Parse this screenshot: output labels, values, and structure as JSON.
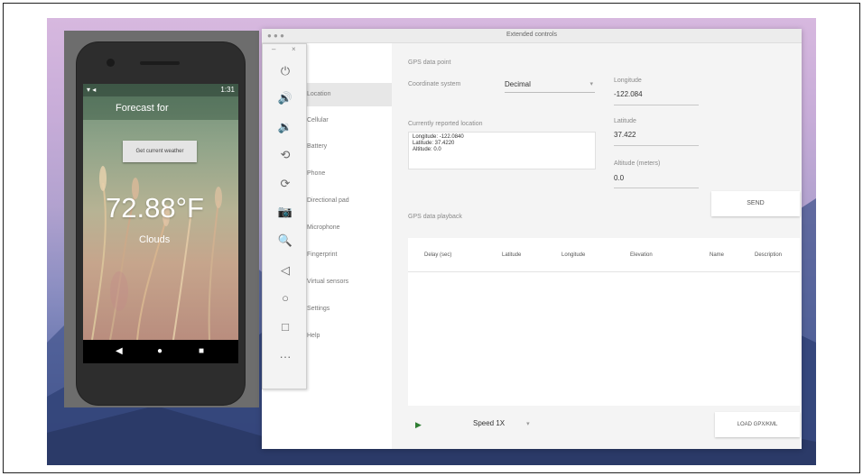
{
  "phone": {
    "status_left": "▾ ◂",
    "status_time": "1:31",
    "app_title": "Forecast for",
    "weather_button": "Get current weather",
    "temperature": "72.88°F",
    "condition": "Clouds"
  },
  "nav": {
    "back": "◀",
    "home": "●",
    "recents": "■"
  },
  "toolbar": {
    "window_controls": "×",
    "window_min": "–",
    "tools": [
      {
        "name": "power-icon",
        "glyph": "⏻"
      },
      {
        "name": "volume-up-icon",
        "glyph": "🔊"
      },
      {
        "name": "volume-down-icon",
        "glyph": "🔉"
      },
      {
        "name": "rotate-left-icon",
        "glyph": "⟲"
      },
      {
        "name": "rotate-right-icon",
        "glyph": "⟳"
      },
      {
        "name": "camera-icon",
        "glyph": "📷"
      },
      {
        "name": "zoom-icon",
        "glyph": "🔍"
      },
      {
        "name": "back-icon",
        "glyph": "◁"
      },
      {
        "name": "home-icon",
        "glyph": "○"
      },
      {
        "name": "overview-icon",
        "glyph": "□"
      },
      {
        "name": "more-icon",
        "glyph": "···"
      }
    ]
  },
  "window": {
    "title": "Extended controls",
    "dots": "● ● ●",
    "sidebar": [
      {
        "label": "Location",
        "active": true
      },
      {
        "label": "Cellular"
      },
      {
        "label": "Battery"
      },
      {
        "label": "Phone"
      },
      {
        "label": "Directional pad"
      },
      {
        "label": "Microphone"
      },
      {
        "label": "Fingerprint"
      },
      {
        "label": "Virtual sensors"
      },
      {
        "label": "Settings"
      },
      {
        "label": "Help"
      }
    ],
    "location": {
      "section_manual": "GPS data point",
      "coord_system_label": "Coordinate system",
      "coord_system_value": "Decimal",
      "longitude_label": "Longitude",
      "longitude_value": "-122.084",
      "currently_label": "Currently reported location",
      "currently_lines": [
        "Longitude: -122.0840",
        "Latitude: 37.4220",
        "Altitude: 0.0"
      ],
      "latitude_label": "Latitude",
      "latitude_value": "37.422",
      "altitude_label": "Altitude (meters)",
      "altitude_value": "0.0",
      "send_button": "SEND",
      "section_playback": "GPS data playback",
      "columns": [
        "Delay (sec)",
        "Latitude",
        "Longitude",
        "Elevation",
        "Name",
        "Description"
      ],
      "speed_label": "Speed 1X",
      "load_button": "LOAD GPX/KML"
    }
  }
}
